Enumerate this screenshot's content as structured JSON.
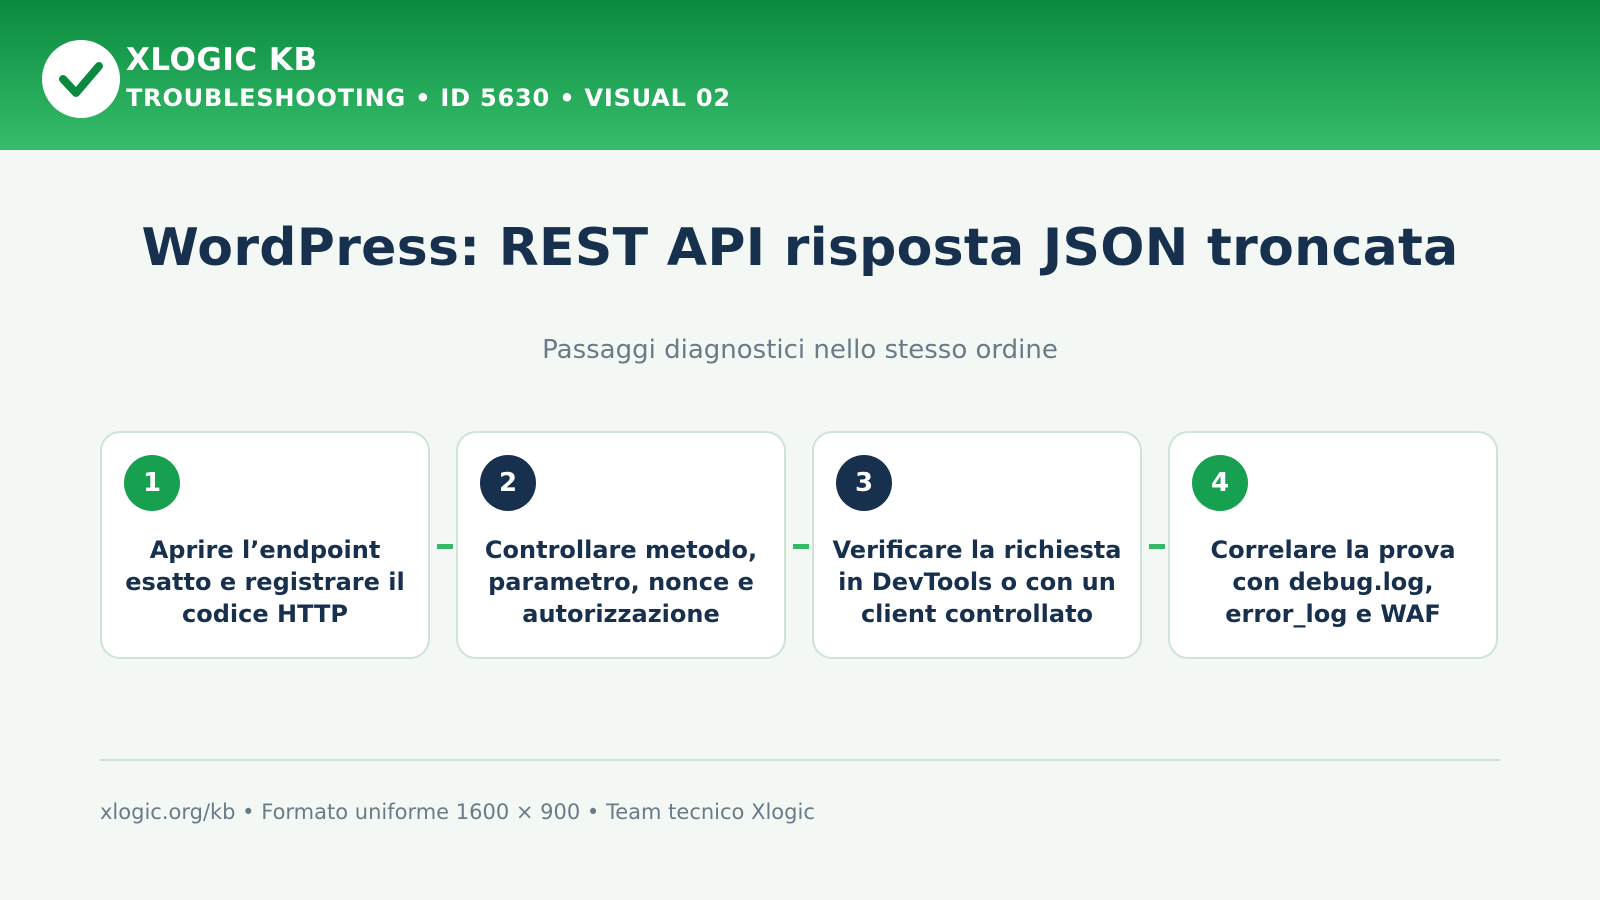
{
  "header": {
    "brand": "XLOGIC KB",
    "subtitle": "TROUBLESHOOTING • ID 5630 • VISUAL 02",
    "logo_icon": "check-icon"
  },
  "main": {
    "title": "WordPress: REST API risposta JSON troncata",
    "subtitle": "Passaggi diagnostici nello stesso ordine"
  },
  "steps": [
    {
      "number": "1",
      "text": "Aprire l’endpoint esatto e registrare il codice HTTP",
      "badge_color": "#16a050"
    },
    {
      "number": "2",
      "text": "Controllare metodo, parametro, nonce e autorizzazione",
      "badge_color": "#17304e"
    },
    {
      "number": "3",
      "text": "Verificare la richiesta in DevTools o con un client controllato",
      "badge_color": "#17304e"
    },
    {
      "number": "4",
      "text": "Correlare la prova con debug.log, error_log e WAF",
      "badge_color": "#16a050"
    }
  ],
  "footer": {
    "text": "xlogic.org/kb • Formato uniforme 1600 × 900 • Team tecnico Xlogic"
  },
  "colors": {
    "header_top": "#0a8a3f",
    "header_bottom": "#36bd6b",
    "accent_green": "#16a050",
    "navy": "#17304e",
    "connector": "#34b86a"
  }
}
